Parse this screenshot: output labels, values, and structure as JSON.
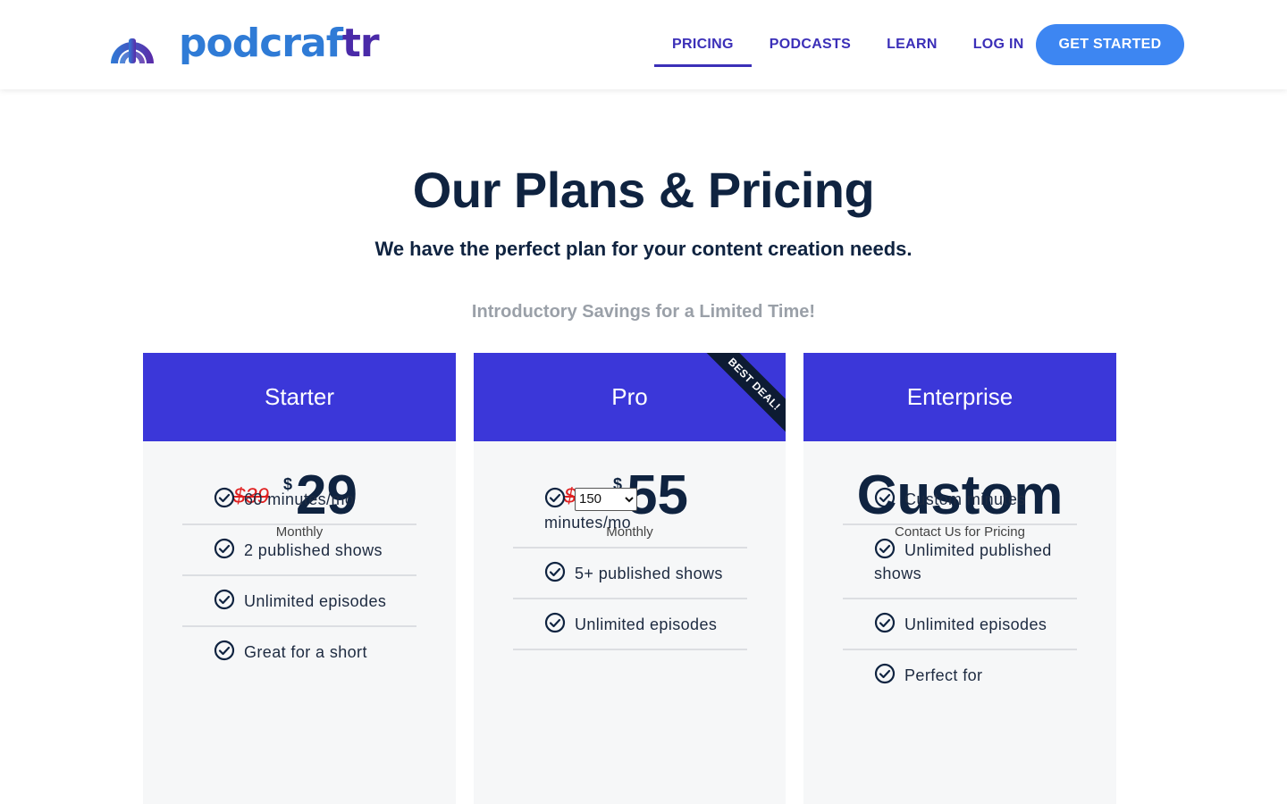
{
  "brand": {
    "name_main": "podcraf",
    "name_tail": "tr"
  },
  "nav": {
    "items": [
      {
        "label": "PRICING",
        "active": true
      },
      {
        "label": "PODCASTS"
      },
      {
        "label": "LEARN"
      },
      {
        "label": "LOG IN"
      }
    ],
    "cta_label": "GET STARTED"
  },
  "hero": {
    "title": "Our Plans & Pricing",
    "subtitle": "We have the perfect plan for your content creation needs.",
    "savings": "Introductory Savings for a Limited Time!"
  },
  "plans": [
    {
      "name": "Starter",
      "old_price": "$39",
      "currency": "$",
      "price": "29",
      "period": "Monthly",
      "features": [
        "60 minutes/mo",
        "2 published shows",
        "Unlimited episodes",
        "Great for a short"
      ]
    },
    {
      "name": "Pro",
      "ribbon": "BEST DEAL!",
      "old_price": "$75",
      "currency": "$",
      "price": "55",
      "period": "Monthly",
      "minutes_option": "150",
      "minutes_suffix": "minutes/mo",
      "features": [
        "5+ published shows",
        "Unlimited episodes"
      ]
    },
    {
      "name": "Enterprise",
      "price": "Custom",
      "period": "Contact Us for Pricing",
      "features": [
        "Custom minutes",
        "Unlimited published shows",
        "Unlimited episodes",
        "Perfect for"
      ]
    }
  ],
  "colors": {
    "accent": "#3b37d9",
    "nav_text": "#3b2fb8",
    "cta": "#3d86f2",
    "strike_red": "#e02020",
    "ribbon": "#0d1b33"
  }
}
